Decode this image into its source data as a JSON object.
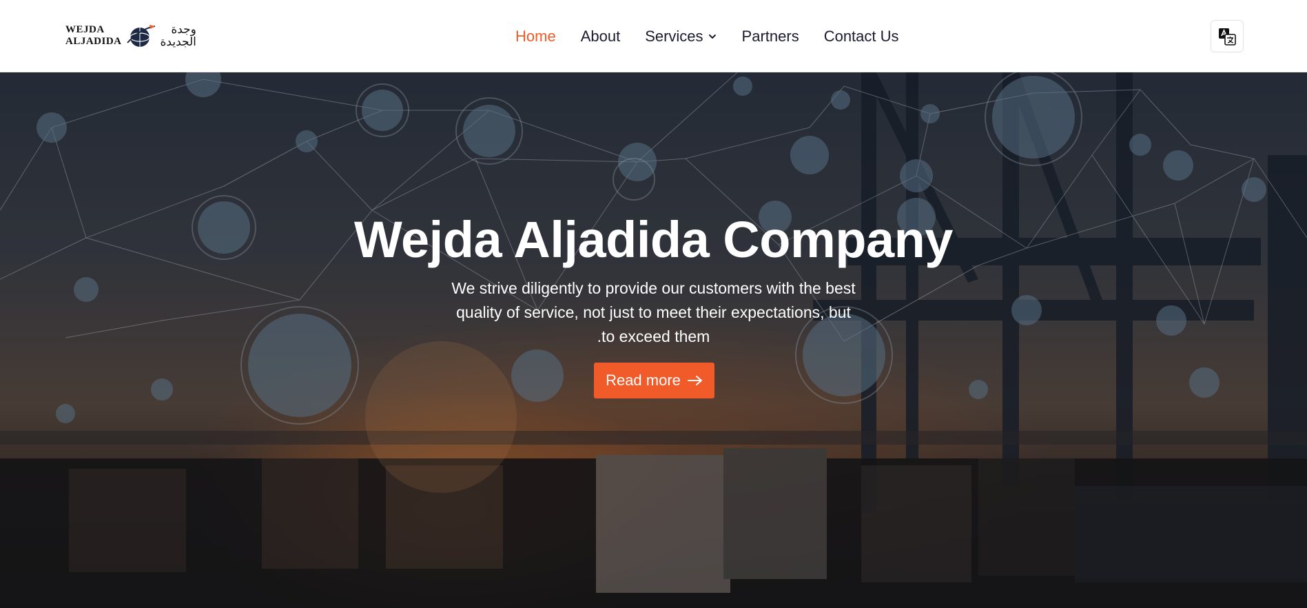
{
  "brand": {
    "latin_line1": "WEJDA",
    "latin_line2": "ALJADIDA",
    "arabic_line1": "وجدة",
    "arabic_line2": "الجديدة"
  },
  "nav": {
    "items": [
      {
        "label": "Home",
        "active": true
      },
      {
        "label": "About",
        "active": false
      },
      {
        "label": "Services",
        "active": false,
        "dropdown": true
      },
      {
        "label": "Partners",
        "active": false
      },
      {
        "label": "Contact Us",
        "active": false
      }
    ]
  },
  "language_button": {
    "icon": "translate-icon"
  },
  "hero": {
    "title": "Wejda Aljadida Company",
    "text_lines": [
      "We strive diligently to provide our customers with the best",
      "quality of service, not just to meet their expectations, but",
      ".to exceed them"
    ],
    "cta_label": "Read more",
    "cta_icon": "arrow-right-icon"
  },
  "colors": {
    "accent": "#f05a28",
    "nav_text": "#1b1b2f",
    "header_bg": "#ffffff"
  }
}
